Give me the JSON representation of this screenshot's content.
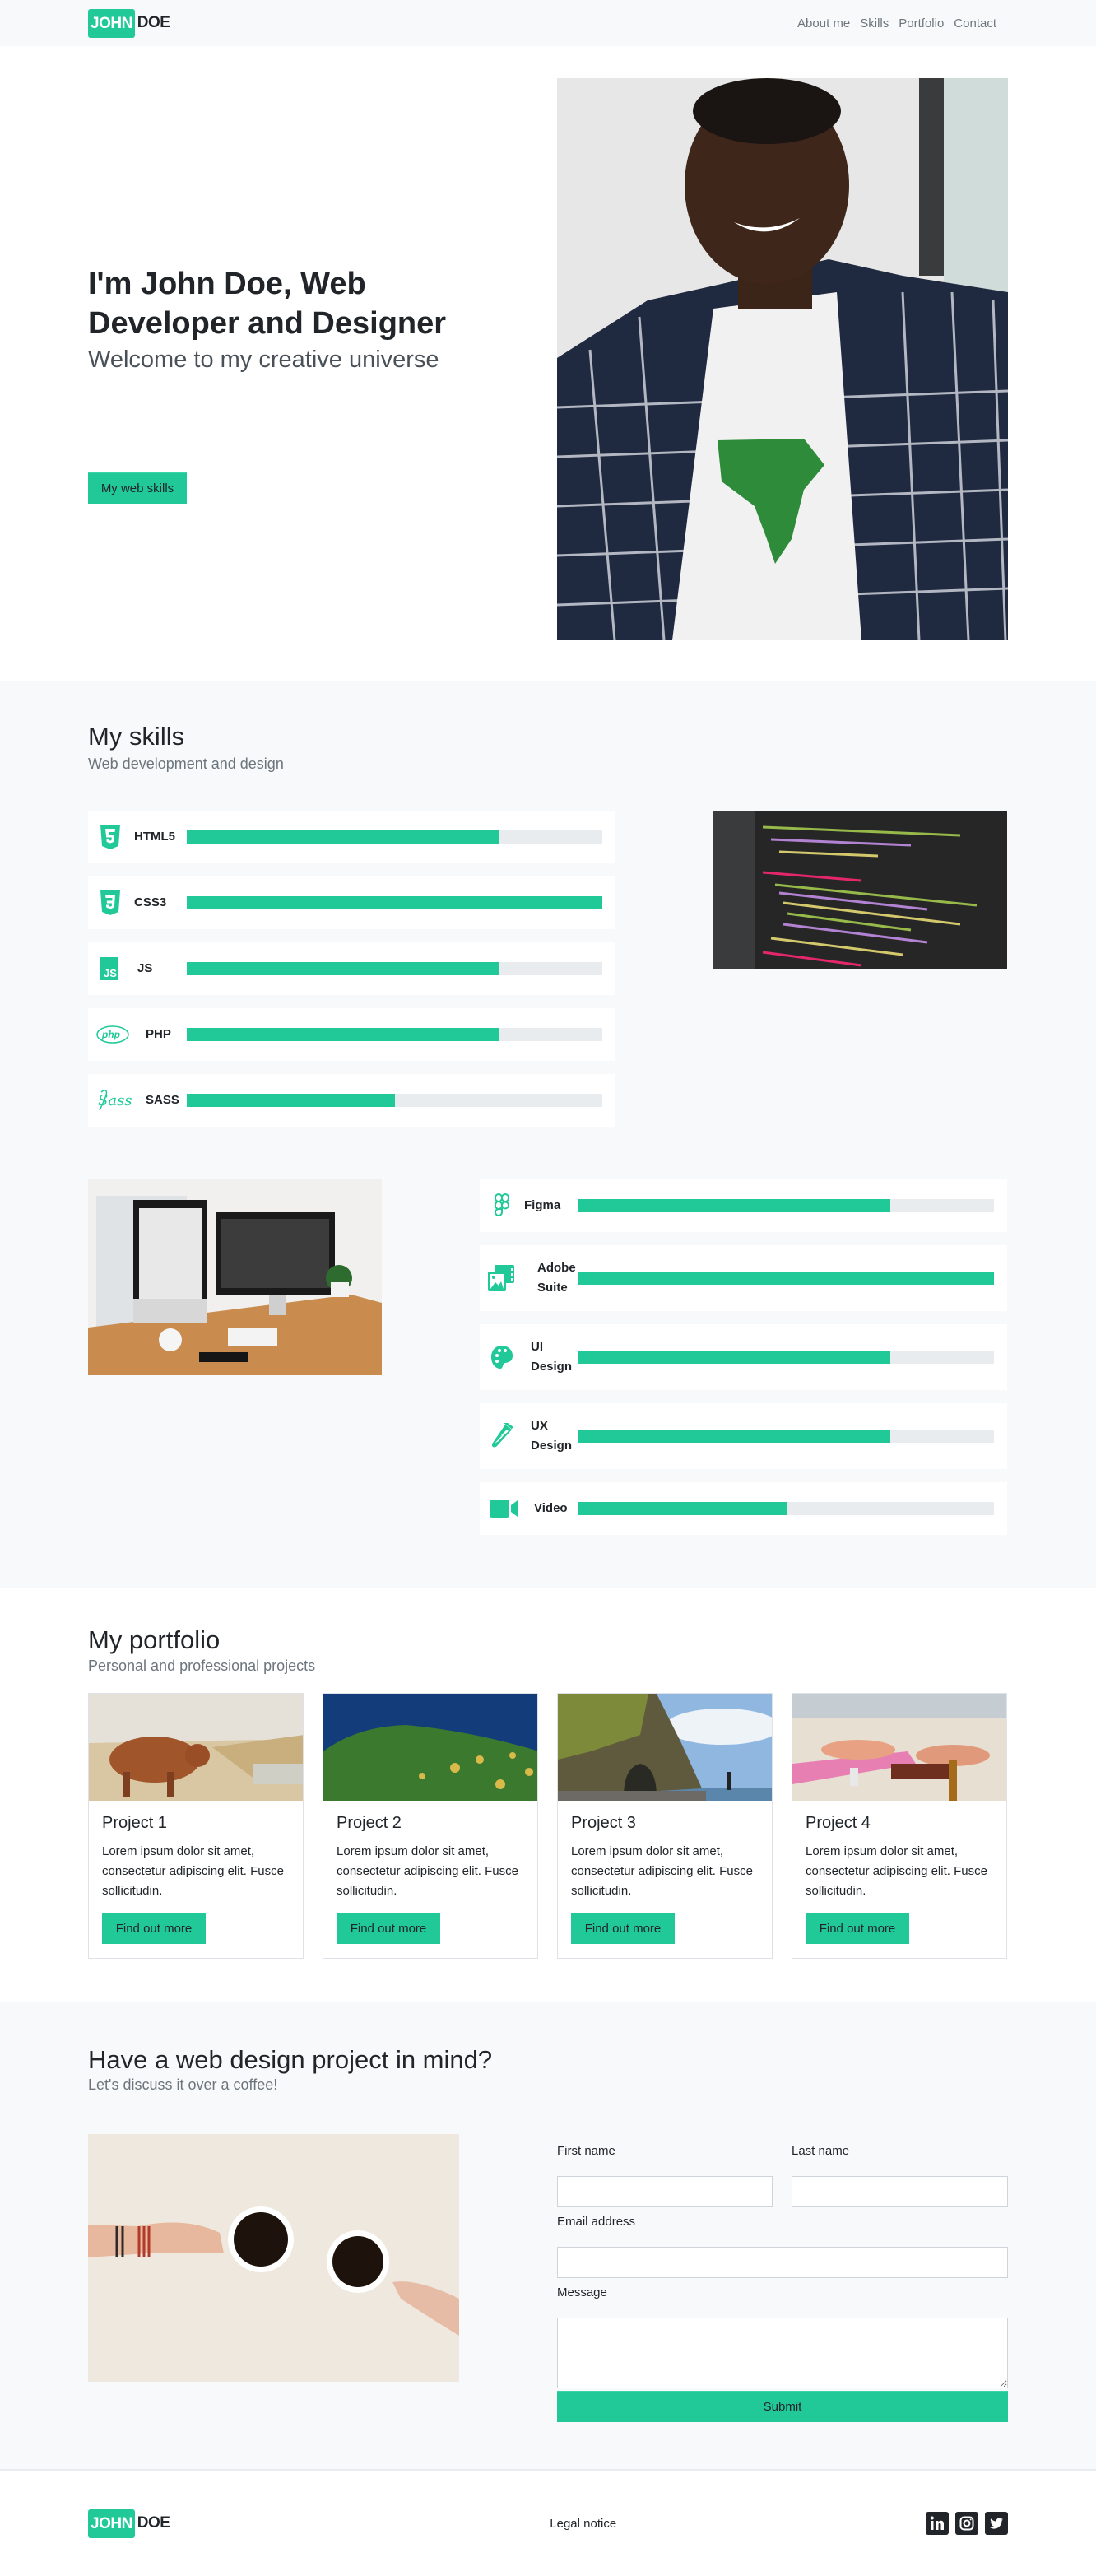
{
  "brand": {
    "first": "JOHN",
    "last": "DOE"
  },
  "nav": {
    "links": [
      "About me",
      "Skills",
      "Portfolio",
      "Contact"
    ]
  },
  "hero": {
    "title": "I'm John Doe, Web Developer and Designer",
    "subtitle": "Welcome to my creative universe",
    "button": "My web skills",
    "photo_alt": "Portrait photo"
  },
  "skills": {
    "title": "My skills",
    "subtitle": "Web development and design",
    "dev": [
      {
        "name": "HTML5",
        "icon": "html5-icon",
        "level": 75
      },
      {
        "name": "CSS3",
        "icon": "css3-icon",
        "level": 100
      },
      {
        "name": "JS",
        "icon": "js-icon",
        "level": 75
      },
      {
        "name": "PHP",
        "icon": "php-icon",
        "level": 75
      },
      {
        "name": "SASS",
        "icon": "sass-icon",
        "level": 50
      }
    ],
    "design": [
      {
        "name": "Figma",
        "icon": "figma-icon",
        "level": 75
      },
      {
        "name": "Adobe Suite",
        "icon": "photo-film-icon",
        "level": 100
      },
      {
        "name": "UI Design",
        "icon": "palette-icon",
        "level": 75
      },
      {
        "name": "UX Design",
        "icon": "flask-icon",
        "level": 75
      },
      {
        "name": "Video",
        "icon": "video-icon",
        "level": 50
      }
    ],
    "code_image_alt": "Code editor screenshot",
    "desk_image_alt": "Desk with monitors"
  },
  "portfolio": {
    "title": "My portfolio",
    "subtitle": "Personal and professional projects",
    "projects": [
      {
        "title": "Project 1",
        "text": "Lorem ipsum dolor sit amet, consectetur adipiscing elit. Fusce sollicitudin.",
        "button": "Find out more"
      },
      {
        "title": "Project 2",
        "text": "Lorem ipsum dolor sit amet, consectetur adipiscing elit. Fusce sollicitudin.",
        "button": "Find out more"
      },
      {
        "title": "Project 3",
        "text": "Lorem ipsum dolor sit amet, consectetur adipiscing elit. Fusce sollicitudin.",
        "button": "Find out more"
      },
      {
        "title": "Project 4",
        "text": "Lorem ipsum dolor sit amet, consectetur adipiscing elit. Fusce sollicitudin.",
        "button": "Find out more"
      }
    ]
  },
  "contact": {
    "title": "Have a web design project in mind?",
    "subtitle": "Let's discuss it over a coffee!",
    "first_name_label": "First name",
    "first_name_value": "",
    "last_name_label": "Last name",
    "last_name_value": "",
    "email_label": "Email address",
    "email_value": "",
    "message_label": "Message",
    "message_value": "",
    "submit": "Submit"
  },
  "footer": {
    "legal": "Legal notice",
    "socials": [
      "linkedin",
      "instagram",
      "twitter"
    ]
  },
  "colors": {
    "accent": "#20c997",
    "light_bg": "#f8f9fa",
    "text": "#212529",
    "muted": "#6c757d",
    "bar_track": "#e9ecef"
  }
}
